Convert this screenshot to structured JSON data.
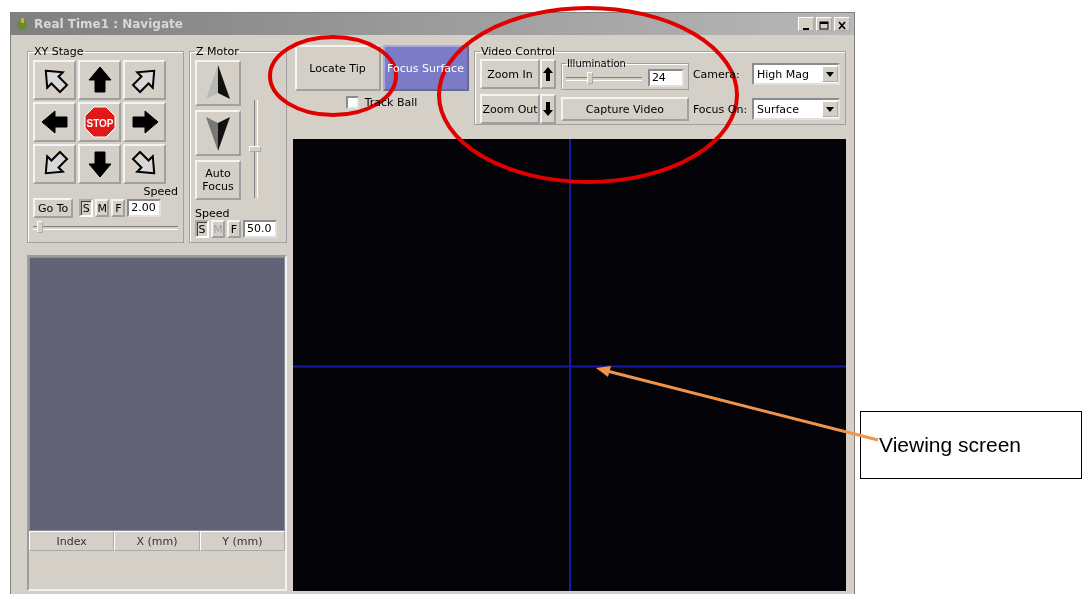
{
  "window": {
    "title": "Real Time1 : Navigate"
  },
  "xy_stage": {
    "title": "XY Stage",
    "stop": "STOP",
    "speed_label": "Speed",
    "goto": "Go To",
    "speed_value": "2.00",
    "slider": {
      "level": 0.03
    },
    "speed_buttons": [
      {
        "label": "S",
        "selected": true,
        "disabled": false
      },
      {
        "label": "M",
        "selected": false,
        "disabled": false
      },
      {
        "label": "F",
        "selected": false,
        "disabled": false
      }
    ]
  },
  "z_motor": {
    "title": "Z Motor",
    "auto_focus": "Auto Focus",
    "speed_label": "Speed",
    "speed_value": "50.0",
    "slider": {
      "level": 0.5
    },
    "speed_buttons": [
      {
        "label": "S",
        "selected": true,
        "disabled": false
      },
      {
        "label": "M",
        "selected": false,
        "disabled": true
      },
      {
        "label": "F",
        "selected": false,
        "disabled": false
      }
    ]
  },
  "point_list": {
    "columns": [
      "Index",
      "X (mm)",
      "Y (mm)"
    ]
  },
  "locate_tip": "Locate Tip",
  "focus_surface": {
    "label": "Focus Surface",
    "selected": true
  },
  "track_ball": {
    "label": "Track Ball",
    "checked": false
  },
  "video_control": {
    "title": "Video Control",
    "zoom_in": "Zoom In",
    "zoom_out": "Zoom Out",
    "illumination": {
      "title": "Illumination",
      "level": 0.3,
      "value": "24"
    },
    "capture": "Capture Video",
    "camera": {
      "label": "Camera:",
      "value": "High Mag"
    },
    "focus_on": {
      "label": "Focus On:",
      "value": "Surface"
    }
  },
  "annotation": {
    "callout": "Viewing screen"
  }
}
